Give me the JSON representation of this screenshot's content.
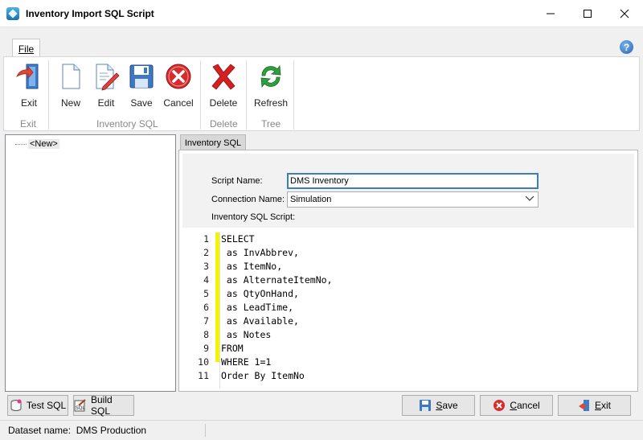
{
  "window": {
    "title": "Inventory Import SQL Script"
  },
  "ribbon": {
    "file_tab": "File",
    "buttons": {
      "exit": "Exit",
      "new": "New",
      "edit": "Edit",
      "save": "Save",
      "cancel": "Cancel",
      "delete": "Delete",
      "refresh": "Refresh"
    },
    "groups": {
      "exit": "Exit",
      "inventory_sql": "Inventory SQL",
      "delete": "Delete",
      "tree": "Tree"
    }
  },
  "tree": {
    "items": [
      {
        "label": "<New>"
      }
    ]
  },
  "panel": {
    "tab": "Inventory SQL",
    "script_name_label": "Script Name:",
    "script_name_value": "DMS Inventory",
    "connection_label": "Connection Name:",
    "connection_value": "Simulation",
    "script_label": "Inventory SQL Script:"
  },
  "editor": {
    "lines": [
      {
        "n": "1",
        "text": "SELECT"
      },
      {
        "n": "2",
        "text": " as InvAbbrev,"
      },
      {
        "n": "3",
        "text": " as ItemNo,"
      },
      {
        "n": "4",
        "text": " as AlternateItemNo,"
      },
      {
        "n": "5",
        "text": " as QtyOnHand,"
      },
      {
        "n": "6",
        "text": " as LeadTime,"
      },
      {
        "n": "7",
        "text": " as Available,"
      },
      {
        "n": "8",
        "text": " as Notes"
      },
      {
        "n": "9",
        "text": "FROM"
      },
      {
        "n": "10",
        "text": "WHERE 1=1"
      },
      {
        "n": "11",
        "text": "Order By ItemNo"
      }
    ]
  },
  "bottom": {
    "test_sql": "Test SQL",
    "build_sql": "Build SQL",
    "save": "Save",
    "cancel": "Cancel",
    "exit": "Exit"
  },
  "status": {
    "dataset_label": "Dataset name:",
    "dataset_value": "DMS Production"
  },
  "colors": {
    "accent": "#3c7fb1",
    "gutter_marker": "#f4f400",
    "cancel_red": "#d92b2b",
    "refresh_green": "#2e9e3e"
  }
}
